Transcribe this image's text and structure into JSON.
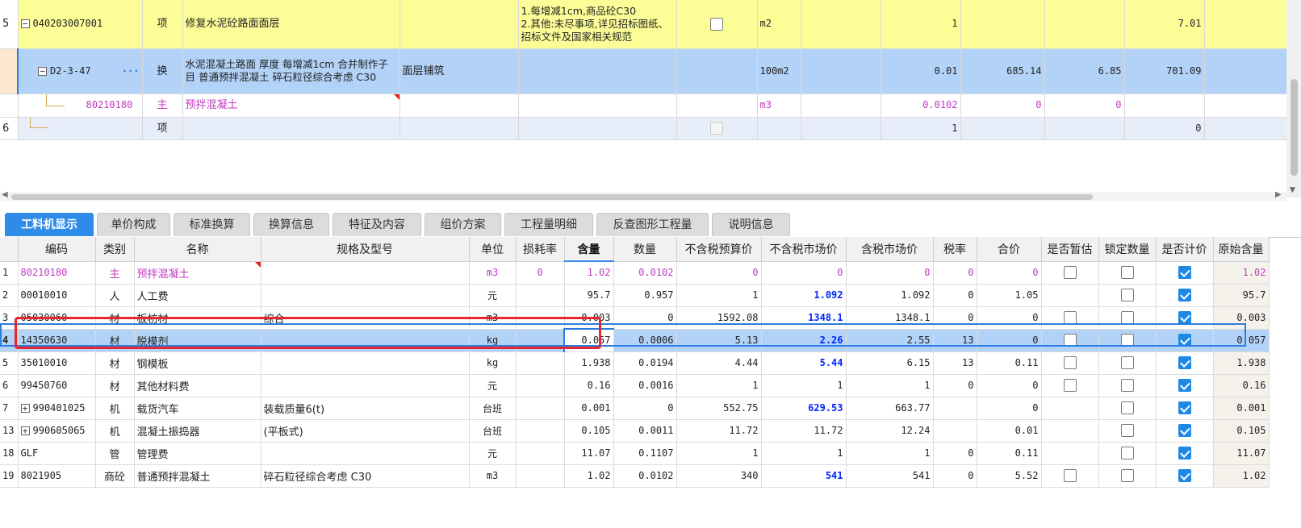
{
  "top_rows": [
    {
      "num": "5",
      "code": "040203007001",
      "type": "项",
      "name": "修复水泥砼路面面层",
      "desc": "1.每增减1cm,商品砼C30\n2.其他:未尽事项,详见招标图纸、招标文件及国家相关规范",
      "unit": "m2",
      "qty": "1",
      "price": "",
      "sub": "",
      "total": "7.01"
    },
    {
      "num": "",
      "code": "D2-3-47",
      "type": "换",
      "name": "水泥混凝土路面 厚度 每增减1cm  合并制作子目 普通预拌混凝土 碎石粒径综合考虑 C30",
      "name_extra": "面层铺筑",
      "unit": "100m2",
      "qty": "0.01",
      "price": "685.14",
      "sub": "6.85",
      "total": "701.09",
      "more": "···"
    },
    {
      "num": "",
      "code": "80210180",
      "type": "主",
      "name": "预拌混凝土",
      "unit": "m3",
      "qty": "0.0102",
      "price": "0",
      "sub": "0",
      "total": ""
    },
    {
      "num": "6",
      "code": "",
      "type": "项",
      "name": "",
      "unit": "",
      "qty": "1",
      "price": "",
      "sub": "",
      "total": "0"
    }
  ],
  "tabs": [
    "工料机显示",
    "单价构成",
    "标准换算",
    "换算信息",
    "特征及内容",
    "组价方案",
    "工程量明细",
    "反查图形工程量",
    "说明信息"
  ],
  "columns": [
    "编码",
    "类别",
    "名称",
    "规格及型号",
    "单位",
    "损耗率",
    "含量",
    "数量",
    "不含税预算价",
    "不含税市场价",
    "含税市场价",
    "税率",
    "合价",
    "是否暂估",
    "锁定数量",
    "是否计价",
    "原始含量"
  ],
  "rows": [
    {
      "n": "1",
      "code": "80210180",
      "cat": "主",
      "name": "预拌混凝土",
      "spec": "",
      "unit": "m3",
      "loss": "0",
      "content": "1.02",
      "qty": "0.0102",
      "bprice": "0",
      "mprice": "0",
      "tprice": "0",
      "tax": "0",
      "total": "0",
      "est": false,
      "lock": false,
      "charge": true,
      "orig": "1.02"
    },
    {
      "n": "2",
      "code": "00010010",
      "cat": "人",
      "name": "人工费",
      "spec": "",
      "unit": "元",
      "loss": "",
      "content": "95.7",
      "qty": "0.957",
      "bprice": "1",
      "mprice": "1.092",
      "tprice": "1.092",
      "tax": "0",
      "total": "1.05",
      "est": null,
      "lock": false,
      "charge": true,
      "orig": "95.7"
    },
    {
      "n": "3",
      "code": "05030060",
      "cat": "材",
      "name": "板枋材",
      "spec": "综合",
      "unit": "m3",
      "loss": "",
      "content": "0.003",
      "qty": "0",
      "bprice": "1592.08",
      "mprice": "1348.1",
      "tprice": "1348.1",
      "tax": "0",
      "total": "0",
      "est": false,
      "lock": false,
      "charge": true,
      "orig": "0.003"
    },
    {
      "n": "4",
      "code": "14350630",
      "cat": "材",
      "name": "脱模剂",
      "spec": "",
      "unit": "kg",
      "loss": "",
      "content": "0.057",
      "qty": "0.0006",
      "bprice": "5.13",
      "mprice": "2.26",
      "tprice": "2.55",
      "tax": "13",
      "total": "0",
      "est": false,
      "lock": false,
      "charge": true,
      "orig": "0.057"
    },
    {
      "n": "5",
      "code": "35010010",
      "cat": "材",
      "name": "钢模板",
      "spec": "",
      "unit": "kg",
      "loss": "",
      "content": "1.938",
      "qty": "0.0194",
      "bprice": "4.44",
      "mprice": "5.44",
      "tprice": "6.15",
      "tax": "13",
      "total": "0.11",
      "est": false,
      "lock": false,
      "charge": true,
      "orig": "1.938"
    },
    {
      "n": "6",
      "code": "99450760",
      "cat": "材",
      "name": "其他材料费",
      "spec": "",
      "unit": "元",
      "loss": "",
      "content": "0.16",
      "qty": "0.0016",
      "bprice": "1",
      "mprice": "1",
      "tprice": "1",
      "tax": "0",
      "total": "0",
      "est": false,
      "lock": false,
      "charge": true,
      "orig": "0.16"
    },
    {
      "n": "7",
      "code": "990401025",
      "cat": "机",
      "name": "载货汽车",
      "spec": "装载质量6(t)",
      "unit": "台班",
      "loss": "",
      "content": "0.001",
      "qty": "0",
      "bprice": "552.75",
      "mprice": "629.53",
      "tprice": "663.77",
      "tax": "",
      "total": "0",
      "est": null,
      "lock": false,
      "charge": true,
      "orig": "0.001",
      "expand": true
    },
    {
      "n": "13",
      "code": "990605065",
      "cat": "机",
      "name": "混凝土振捣器",
      "spec": "(平板式)",
      "unit": "台班",
      "loss": "",
      "content": "0.105",
      "qty": "0.0011",
      "bprice": "11.72",
      "mprice": "11.72",
      "tprice": "12.24",
      "tax": "",
      "total": "0.01",
      "est": null,
      "lock": false,
      "charge": true,
      "orig": "0.105",
      "expand": true
    },
    {
      "n": "18",
      "code": "GLF",
      "cat": "管",
      "name": "管理费",
      "spec": "",
      "unit": "元",
      "loss": "",
      "content": "11.07",
      "qty": "0.1107",
      "bprice": "1",
      "mprice": "1",
      "tprice": "1",
      "tax": "0",
      "total": "0.11",
      "est": null,
      "lock": false,
      "charge": true,
      "orig": "11.07"
    },
    {
      "n": "19",
      "code": "8021905",
      "cat": "商砼",
      "name": "普通预拌混凝土",
      "spec": "碎石粒径综合考虑 C30",
      "unit": "m3",
      "loss": "",
      "content": "1.02",
      "qty": "0.0102",
      "bprice": "340",
      "mprice": "541",
      "tprice": "541",
      "tax": "0",
      "total": "5.52",
      "est": false,
      "lock": false,
      "charge": true,
      "orig": "1.02"
    }
  ],
  "colors": {
    "accent": "#2e8be8",
    "selected_row": "#b3d2f7",
    "yellow_row": "#fdfd98",
    "highlight_box": "#e8262d",
    "market_price_blue": "#0026ff",
    "main_material_pink": "#c03bc0"
  }
}
